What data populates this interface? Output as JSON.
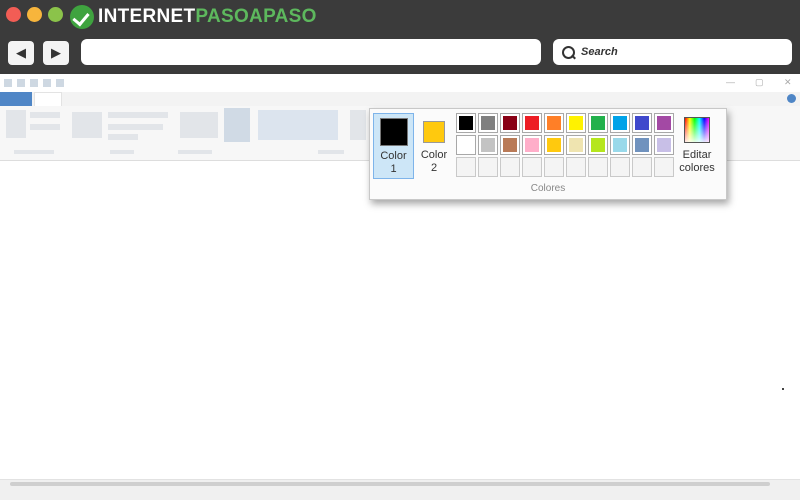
{
  "browser": {
    "logo": {
      "part1": "INTERNET",
      "part2": "PASOAPASO"
    },
    "nav": {
      "back_glyph": "◀",
      "forward_glyph": "▶"
    },
    "search_label": "Search"
  },
  "colors_panel": {
    "color1_label": "Color 1",
    "color2_label": "Color 2",
    "color1_value": "#000000",
    "color2_value": "#ffc90e",
    "edit_colors_label": "Editar colores",
    "group_label": "Colores",
    "palette": [
      [
        "#000000",
        "#7f7f7f",
        "#880015",
        "#ed1c24",
        "#ff7f27",
        "#fff200",
        "#22b14c",
        "#00a2e8",
        "#3f48cc",
        "#a349a4"
      ],
      [
        "#ffffff",
        "#c3c3c3",
        "#b97a57",
        "#ffaec9",
        "#ffc90e",
        "#efe4b0",
        "#b5e61d",
        "#99d9ea",
        "#7092be",
        "#c8bfe7"
      ]
    ],
    "custom_slots": 10
  },
  "icons": {
    "back": "left-arrow-icon",
    "forward": "right-arrow-icon",
    "search": "magnifier-icon",
    "edit_colors": "color-spectrum-icon"
  }
}
